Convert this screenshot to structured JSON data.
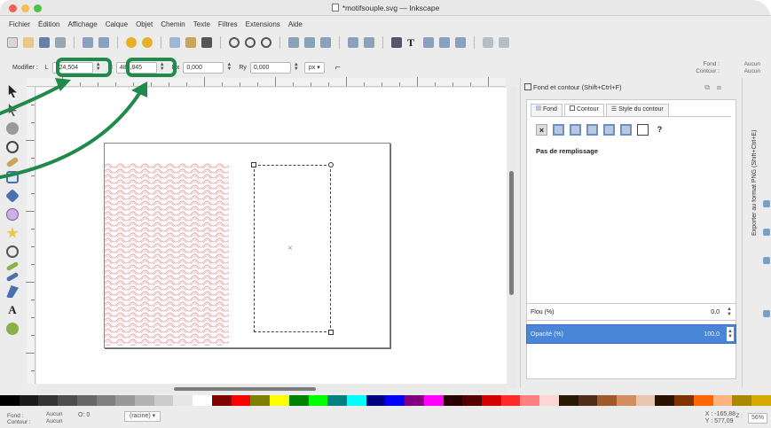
{
  "window": {
    "title": "*motifsouple.svg — Inkscape"
  },
  "menu": {
    "items": [
      "Fichier",
      "Édition",
      "Affichage",
      "Calque",
      "Objet",
      "Chemin",
      "Texte",
      "Filtres",
      "Extensions",
      "Aide"
    ]
  },
  "controls": {
    "modifier_label": "Modifier :",
    "l_label": "L",
    "l_value": "224,504",
    "h_label": "H",
    "h_value": "486,845",
    "rx_label": "Rx",
    "rx_value": "0,000",
    "ry_label": "Ry",
    "ry_value": "0,000",
    "unit": "px"
  },
  "style_indicator": {
    "fond_label": "Fond :",
    "contour_label": "Contour :",
    "fond_value": "Aucun",
    "contour_value": "Aucun"
  },
  "dock": {
    "title": "Fond et contour (Shift+Ctrl+F)",
    "tabs": [
      "Fond",
      "Contour",
      "Style du contour"
    ],
    "paint_x": "×",
    "paint_unset": "?",
    "no_fill_text": "Pas de remplissage",
    "flou_label": "Flou (%)",
    "flou_value": "0,0",
    "opacity_label": "Opacité (%)",
    "opacity_value": "100,0"
  },
  "side_panel": {
    "export_label": "Exporter au format PNG (Shift+Ctrl+E)"
  },
  "status": {
    "fond_label": "Fond :",
    "fond_value": "Aucun",
    "contour_label": "Contour :",
    "contour_value": "Aucun",
    "opacity_value": "0",
    "layer": "(racine)",
    "x_label": "X :",
    "x_value": "-165,88",
    "y_label": "Y :",
    "y_value": "577,09",
    "z_label": "Z :",
    "zoom": "56%"
  },
  "canvas": {
    "center_mark": "×"
  },
  "colors": {
    "highlight": "#1f8a4c",
    "pattern": "#e8a0a0",
    "selection_accent": "#4a86d8"
  }
}
